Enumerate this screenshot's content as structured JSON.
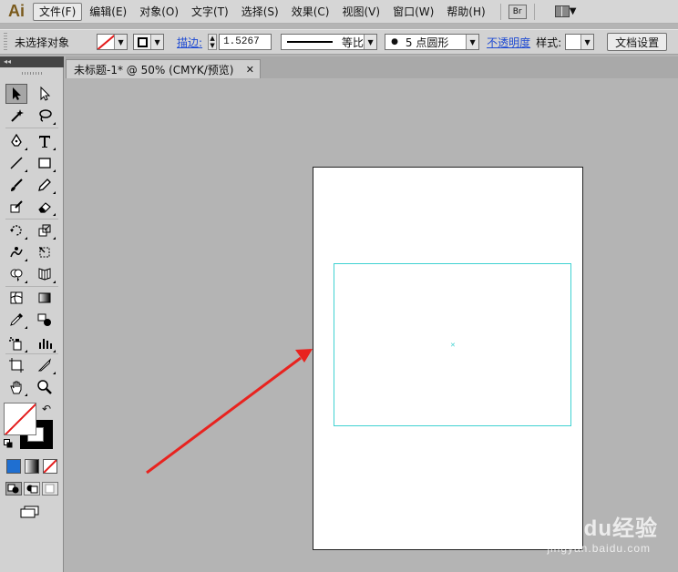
{
  "app": {
    "logo": "Ai"
  },
  "menu": {
    "items": [
      {
        "label": "文件(F)",
        "active": true
      },
      {
        "label": "编辑(E)"
      },
      {
        "label": "对象(O)"
      },
      {
        "label": "文字(T)"
      },
      {
        "label": "选择(S)"
      },
      {
        "label": "效果(C)"
      },
      {
        "label": "视图(V)"
      },
      {
        "label": "窗口(W)"
      },
      {
        "label": "帮助(H)"
      }
    ],
    "bridge_label": "Br"
  },
  "control": {
    "selection_status": "未选择对象",
    "stroke_label": "描边:",
    "stroke_weight": "1.5267",
    "stroke_profile": "等比",
    "brush": "5 点圆形",
    "opacity_label": "不透明度",
    "style_label": "样式:",
    "doc_setup": "文档设置"
  },
  "document": {
    "tab_title": "未标题-1* @ 50% (CMYK/预览)",
    "close": "✕"
  },
  "toolbox": {
    "collapse": "◂◂",
    "swap": "↶"
  },
  "colors": {
    "selection": "#3fd2d2",
    "arrow": "#e8231f",
    "none_slash": "#e41c1c"
  },
  "watermark": {
    "brand": "Baidu经验",
    "url": "jingyan.baidu.com"
  }
}
